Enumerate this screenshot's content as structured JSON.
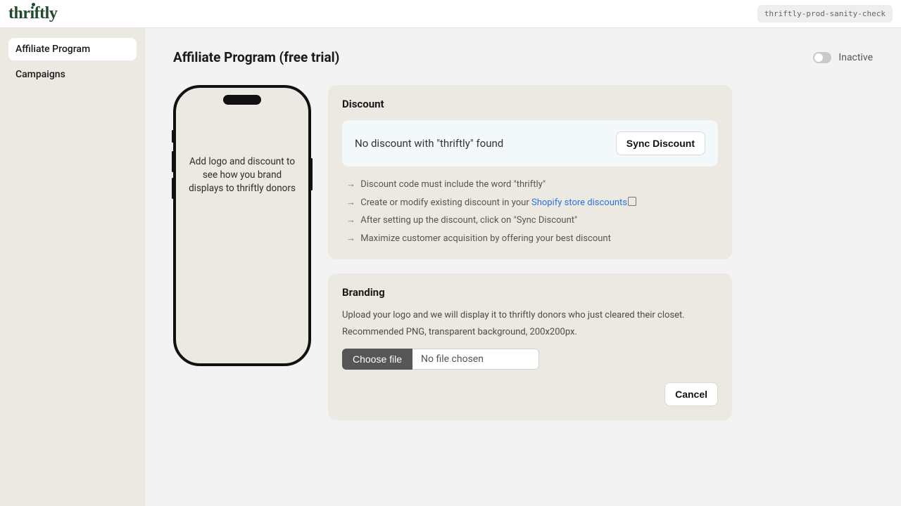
{
  "header": {
    "logo_text": "thriftly",
    "env_badge": "thriftly-prod-sanity-check"
  },
  "sidebar": {
    "items": [
      {
        "label": "Affiliate Program",
        "active": true
      },
      {
        "label": "Campaigns",
        "active": false
      }
    ]
  },
  "page": {
    "title": "Affiliate Program (free trial)",
    "status_label": "Inactive"
  },
  "phone_preview": {
    "placeholder_text": "Add logo and discount to see how you brand displays to thriftly donors"
  },
  "discount_card": {
    "heading": "Discount",
    "status_message": "No discount with \"thriftly\" found",
    "sync_button": "Sync Discount",
    "hints": [
      "Discount code must include the word \"thriftly\"",
      "Create or modify existing discount in your ",
      "After setting up the discount, click on \"Sync Discount\"",
      "Maximize customer acquisition by offering your best discount"
    ],
    "shopify_link_text": "Shopify store discounts"
  },
  "branding_card": {
    "heading": "Branding",
    "desc_line1": "Upload your logo and we will display it to thriftly donors who just cleared their closet.",
    "desc_line2": "Recommended PNG, transparent background, 200x200px.",
    "choose_file_label": "Choose file",
    "file_status": "No file chosen",
    "cancel_button": "Cancel"
  }
}
